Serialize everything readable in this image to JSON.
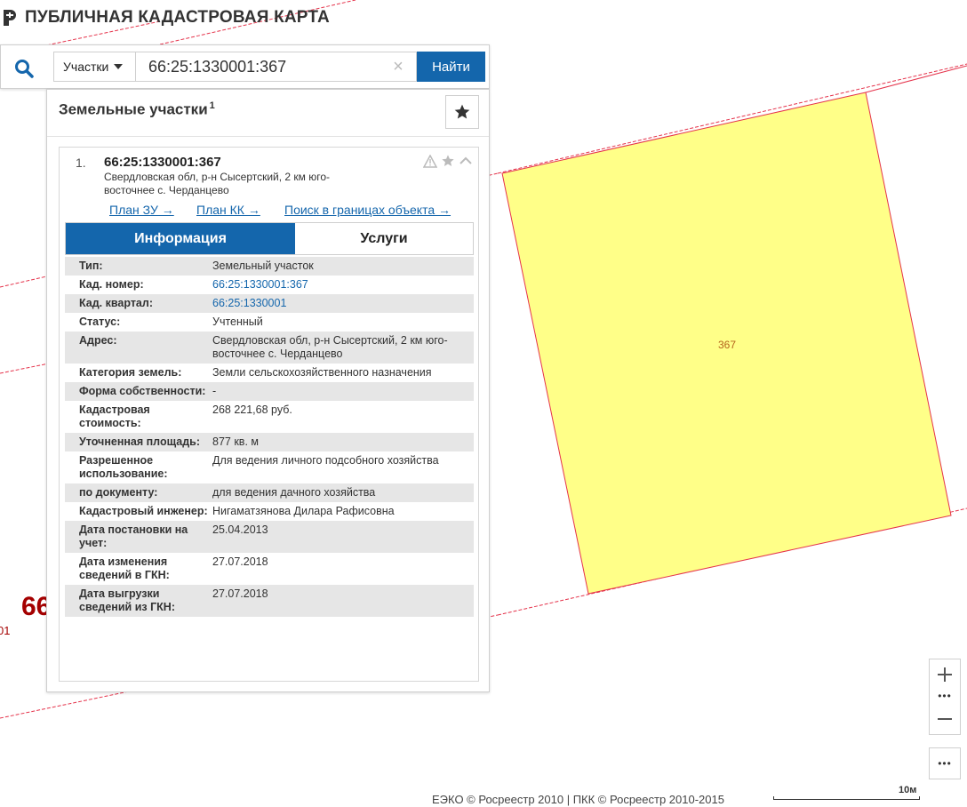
{
  "app": {
    "title": "ПУБЛИЧНАЯ КАДАСТРОВАЯ КАРТА"
  },
  "search": {
    "type_label": "Участки",
    "query": "66:25:1330001:367",
    "find_label": "Найти"
  },
  "panel": {
    "title": "Земельные участки",
    "count": "1"
  },
  "result": {
    "number": "1.",
    "cad_number": "66:25:1330001:367",
    "address": "Свердловская обл, р-н Сысертский, 2 км юго-восточнее с. Черданцево",
    "links": {
      "plan_zu": "План ЗУ →",
      "plan_kk": "План КК →",
      "search_within": "Поиск в границах объекта →"
    },
    "tabs": {
      "info": "Информация",
      "services": "Услуги"
    },
    "info": [
      {
        "label": "Тип:",
        "value": "Земельный участок"
      },
      {
        "label": "Кад. номер:",
        "value": "66:25:1330001:367"
      },
      {
        "label": "Кад. квартал:",
        "value": "66:25:1330001"
      },
      {
        "label": "Статус:",
        "value": "Учтенный"
      },
      {
        "label": "Адрес:",
        "value": "Свердловская обл, р-н Сысертский, 2 км юго-восточнее с. Черданцево"
      },
      {
        "label": "Категория земель:",
        "value": "Земли сельскохозяйственного назначения"
      },
      {
        "label": "Форма собственности:",
        "value": "-"
      },
      {
        "label": "Кадастровая стоимость:",
        "value": "268 221,68 руб."
      },
      {
        "label": "Уточненная площадь:",
        "value": "877 кв. м"
      },
      {
        "label": "Разрешенное использование:",
        "value": "Для ведения личного подсобного хозяйства"
      },
      {
        "label": "по документу:",
        "value": "для ведения дачного хозяйства"
      },
      {
        "label": "Кадастровый инженер:",
        "value": "Нигаматзянова Дилара Рафисовна"
      },
      {
        "label": "Дата постановки на учет:",
        "value": "25.04.2013"
      },
      {
        "label": "Дата изменения сведений в ГКН:",
        "value": "27.07.2018"
      },
      {
        "label": "Дата выгрузки сведений из ГКН:",
        "value": "27.07.2018"
      }
    ]
  },
  "map": {
    "parcel_label": "367",
    "bg_label_large": "66",
    "bg_label_small": "01",
    "parcel_fill": "#ffff88",
    "boundary_color": "#e5334b"
  },
  "controls": {
    "zoom_dots": "•••",
    "more": "•••"
  },
  "footer": {
    "attribution": "ЕЭКО © Росреестр 2010 | ПКК © Росреестр 2010-2015",
    "scale": "10м"
  },
  "colors": {
    "accent": "#1466ac"
  }
}
